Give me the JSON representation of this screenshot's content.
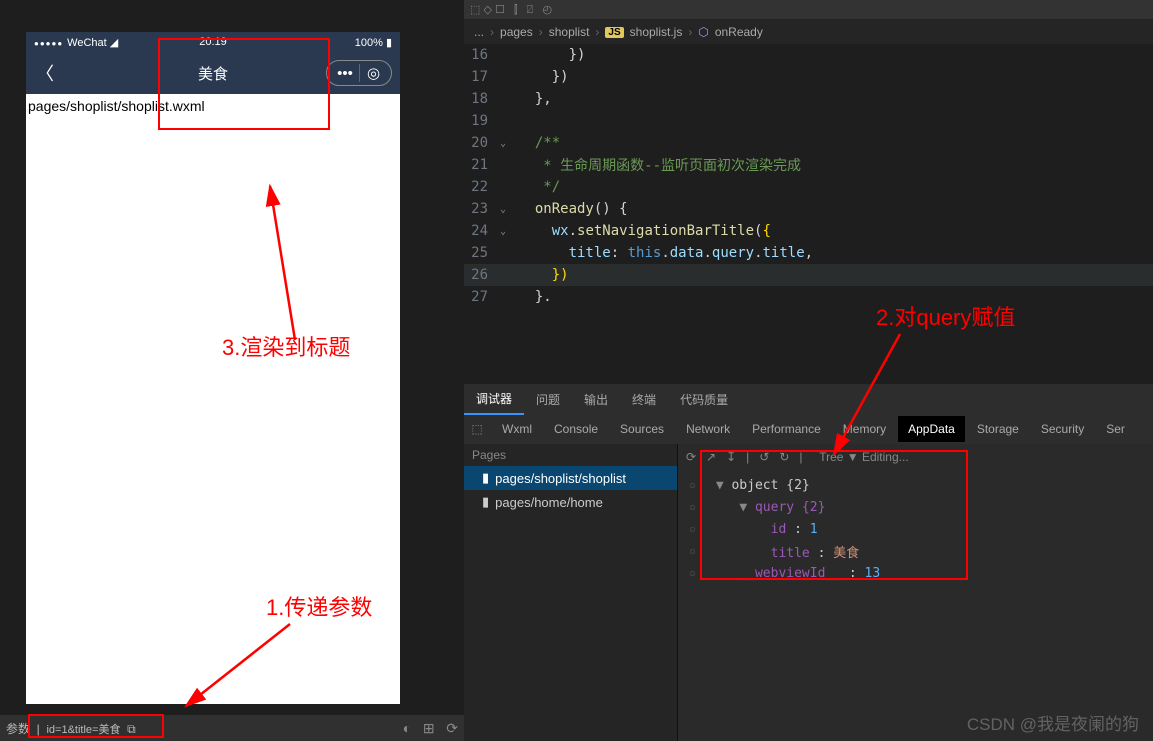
{
  "phone": {
    "carrier": "WeChat",
    "time": "20:19",
    "battery": "100%",
    "title": "美食",
    "body_text": "pages/shoplist/shoplist.wxml"
  },
  "bottom": {
    "params_label": "参数",
    "params_value": "id=1&title=美食"
  },
  "breadcrumb": {
    "root": "...",
    "p1": "pages",
    "p2": "shoplist",
    "file": "shoplist.js",
    "fn": "onReady"
  },
  "code": {
    "lines": [
      {
        "n": "16",
        "t": "    })"
      },
      {
        "n": "17",
        "t": "  })"
      },
      {
        "n": "18",
        "t": "},"
      },
      {
        "n": "19",
        "t": ""
      },
      {
        "n": "20",
        "t": "/**"
      },
      {
        "n": "21",
        "t": " * 生命周期函数--监听页面初次渲染完成"
      },
      {
        "n": "22",
        "t": " */"
      },
      {
        "n": "23",
        "t": "onReady() {"
      },
      {
        "n": "24",
        "t": "  wx.setNavigationBarTitle({"
      },
      {
        "n": "25",
        "t": "    title: this.data.query.title,"
      },
      {
        "n": "26",
        "t": "  })"
      },
      {
        "n": "27",
        "t": "}."
      }
    ]
  },
  "debugger": {
    "tabs_top": [
      "调试器",
      "问题",
      "输出",
      "终端",
      "代码质量"
    ],
    "tool_tabs": [
      "Wxml",
      "Console",
      "Sources",
      "Network",
      "Performance",
      "Memory",
      "AppData",
      "Storage",
      "Security",
      "Ser"
    ],
    "active_tool": "AppData",
    "quick_bar": "Tree  ▼  Editing...",
    "pages_header": "Pages",
    "pages": [
      "pages/shoplist/shoplist",
      "pages/home/home"
    ],
    "tree": {
      "root": "object {2}",
      "query": "query {2}",
      "id_key": "id",
      "id_val": "1",
      "title_key": "title",
      "title_val": "美食",
      "wv_key": "__webviewId__",
      "wv_val": "13"
    }
  },
  "annotations": {
    "a1": "1.传递参数",
    "a2": "2.对query赋值",
    "a3": "3.渲染到标题"
  },
  "watermark": "CSDN @我是夜阑的狗"
}
